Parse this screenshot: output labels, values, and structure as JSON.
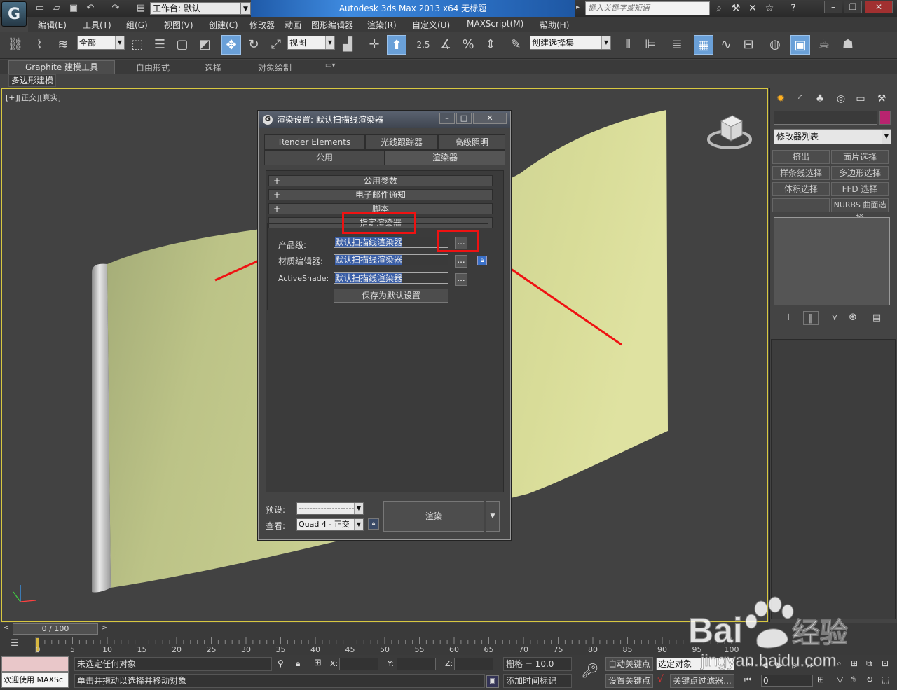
{
  "titlebar": {
    "workspace_label": "工作台: 默认",
    "title": "Autodesk 3ds Max  2013 x64        无标题",
    "search_placeholder": "键入关键字或短语"
  },
  "menu": [
    "编辑(E)",
    "工具(T)",
    "组(G)",
    "视图(V)",
    "创建(C)",
    "修改器",
    "动画",
    "图形编辑器",
    "渲染(R)",
    "自定义(U)",
    "MAXScript(M)",
    "帮助(H)"
  ],
  "toolbar": {
    "selection_filter": "全部",
    "ref_coord": "视图",
    "snap_angle_label": "2.5",
    "named_selection": "创建选择集"
  },
  "ribbon": {
    "tabs": [
      "Graphite 建模工具",
      "自由形式",
      "选择",
      "对象绘制"
    ],
    "sub_tab": "多边形建模"
  },
  "viewport": {
    "label": "[+][正交][真实]"
  },
  "dialog": {
    "title": "渲染设置: 默认扫描线渲染器",
    "tabs_row1": [
      "Render Elements",
      "光线跟踪器",
      "高级照明"
    ],
    "tabs_row2": [
      "公用",
      "渲染器"
    ],
    "rollouts": [
      {
        "sign": "+",
        "label": "公用参数"
      },
      {
        "sign": "+",
        "label": "电子邮件通知"
      },
      {
        "sign": "+",
        "label": "脚本"
      },
      {
        "sign": "-",
        "label": "指定渲染器"
      }
    ],
    "assign": {
      "production_label": "产品级:",
      "production_value": "默认扫描线渲染器",
      "material_label": "材质编辑器:",
      "material_value": "默认扫描线渲染器",
      "activeshade_label": "ActiveShade:",
      "activeshade_value": "默认扫描线渲染器",
      "dots": "...",
      "save_default": "保存为默认设置"
    },
    "footer": {
      "preset_label": "预设:",
      "preset_value": "--------------------",
      "view_label": "查看:",
      "view_value": "Quad 4 - 正交",
      "render_button": "渲染"
    }
  },
  "command_panel": {
    "modifier_list": "修改器列表",
    "buttons": [
      "挤出",
      "面片选择",
      "样条线选择",
      "多边形选择",
      "体积选择",
      "FFD 选择",
      "",
      "NURBS 曲面选择"
    ],
    "color_swatch": "#b8246f"
  },
  "timeline": {
    "frame_display": "0 / 100",
    "ticks": [
      "0",
      "5",
      "10",
      "15",
      "20",
      "25",
      "30",
      "35",
      "40",
      "45",
      "50",
      "55",
      "60",
      "65",
      "70",
      "75",
      "80",
      "85",
      "90",
      "95",
      "100"
    ]
  },
  "status": {
    "maxscript_label": "欢迎使用  MAXSc",
    "selection_status": "未选定任何对象",
    "prompt": "单击并拖动以选择并移动对象",
    "x_label": "X:",
    "y_label": "Y:",
    "z_label": "Z:",
    "grid": "栅格 = 10.0",
    "add_time_tag": "添加时间标记",
    "auto_key": "自动关键点",
    "auto_key_combo": "选定对象",
    "set_key": "设置关键点",
    "key_filters": "关键点过滤器...",
    "frame_field": "0"
  },
  "watermark": {
    "brand": "Bai",
    "brand2": "经验",
    "url": "jingyan.baidu.com"
  },
  "colors": {
    "annotation_red": "#ef1212",
    "surface_yellow": "#d8dc98",
    "viewport_border": "#d8c840"
  }
}
